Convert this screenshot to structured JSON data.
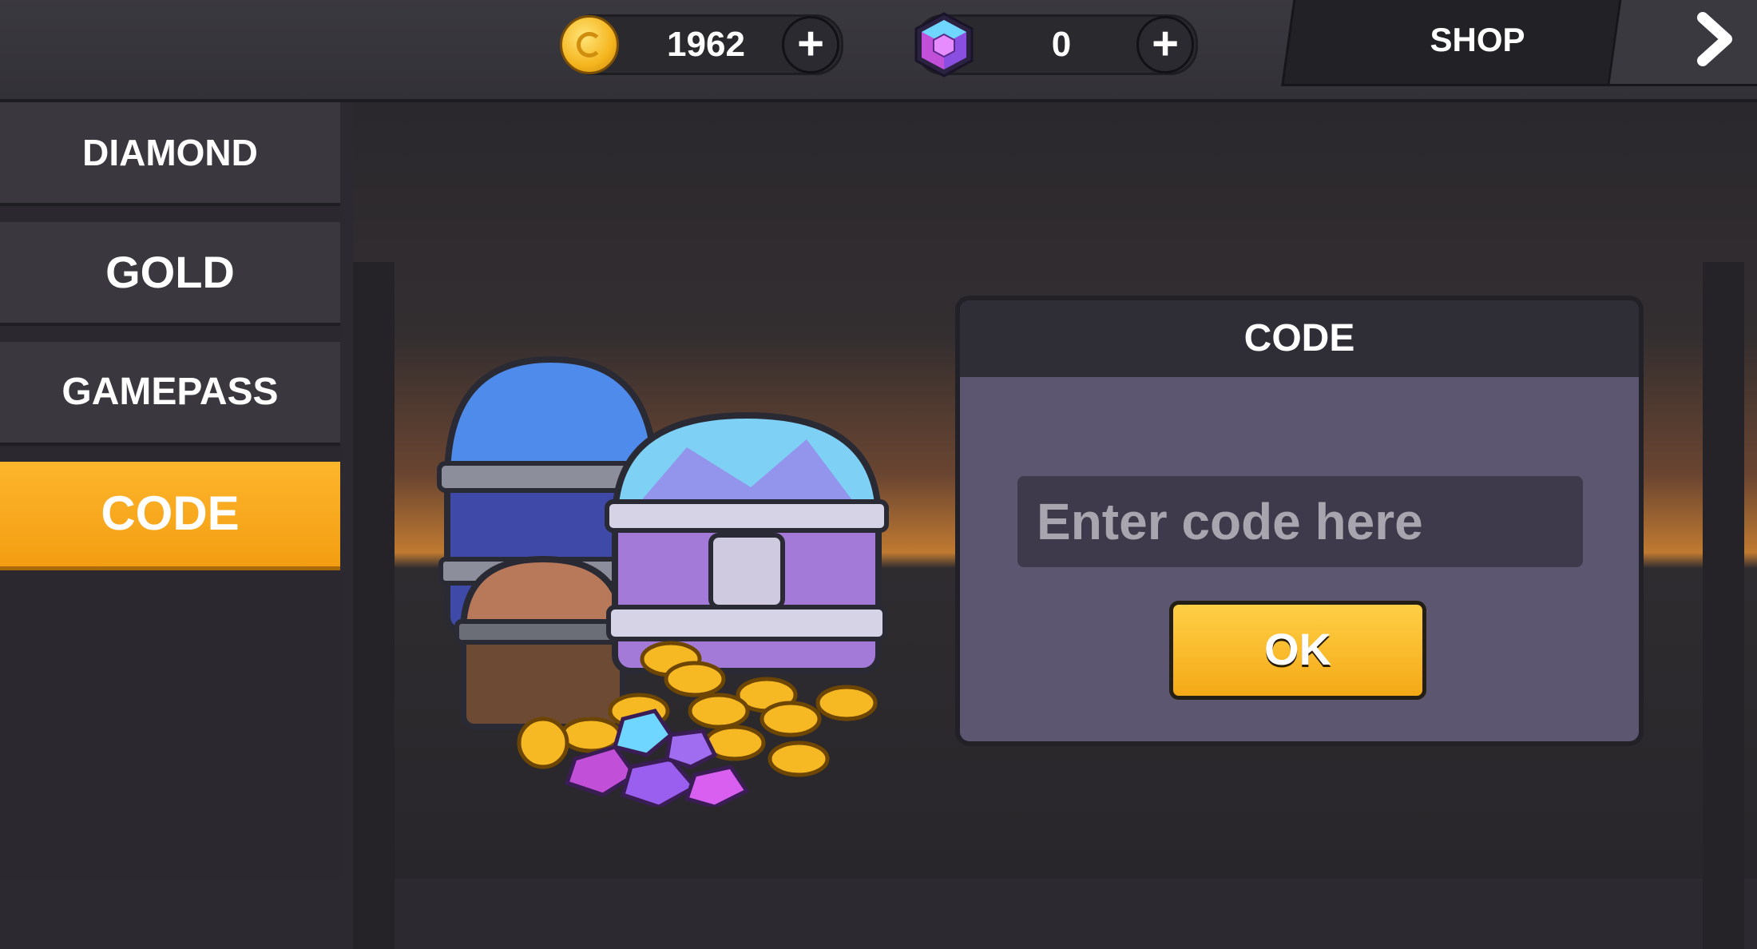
{
  "header": {
    "gold": {
      "icon": "gold-coin-icon",
      "value": "1962"
    },
    "diamonds": {
      "icon": "diamond-gem-icon",
      "value": "0"
    },
    "shop_label": "SHOP",
    "next_icon": "chevron-right-icon"
  },
  "sidebar": {
    "items": [
      {
        "label": "DIAMOND",
        "active": false
      },
      {
        "label": "GOLD",
        "active": false
      },
      {
        "label": "GAMEPASS",
        "active": false
      },
      {
        "label": "CODE",
        "active": true
      }
    ]
  },
  "code_panel": {
    "title": "CODE",
    "input_placeholder": "Enter code here",
    "input_value": "",
    "ok_label": "OK"
  },
  "colors": {
    "accent": "#f7a81b",
    "panel": "#5c5670",
    "panel_header": "#2f2d36"
  }
}
